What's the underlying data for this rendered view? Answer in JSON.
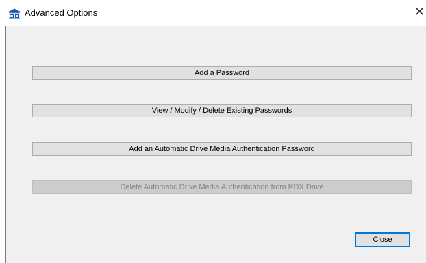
{
  "window": {
    "title": "Advanced Options",
    "close_glyph": "✕",
    "app_icon": "rdx-network-icon"
  },
  "buttons": {
    "add_password": "Add a Password",
    "view_modify_delete": "View / Modify / Delete Existing Passwords",
    "add_auto_auth": "Add an Automatic Drive Media Authentication Password",
    "delete_auto_auth": "Delete Automatic Drive Media Authentication  from RDX Drive",
    "close": "Close"
  },
  "states": {
    "delete_auto_auth_enabled": false,
    "close_focused": true
  },
  "colors": {
    "dialog_background": "#f0f0f0",
    "button_face": "#e1e1e1",
    "disabled_face": "#cccccc",
    "disabled_text": "#838383",
    "focus_border": "#0078d7",
    "icon_blue": "#1e5aa8"
  }
}
